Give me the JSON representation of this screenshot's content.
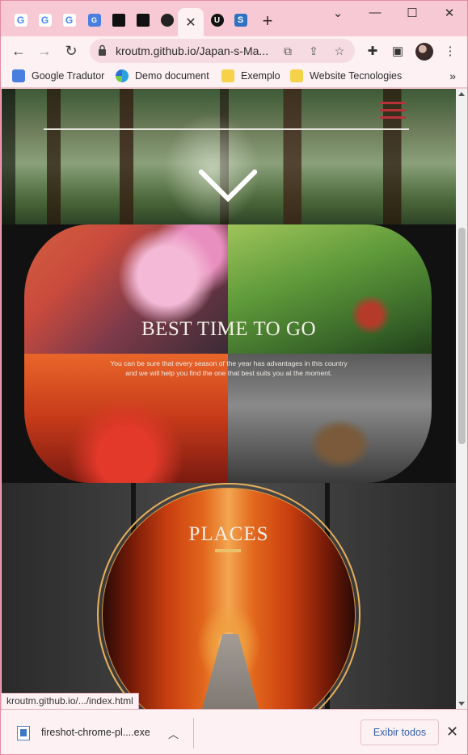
{
  "browser": {
    "tabs": [
      {
        "icon": "google-icon"
      },
      {
        "icon": "google-icon"
      },
      {
        "icon": "google-icon"
      },
      {
        "icon": "translate-icon"
      },
      {
        "icon": "site-icon"
      },
      {
        "icon": "site-icon"
      },
      {
        "icon": "github-icon"
      },
      {
        "icon": "close-icon",
        "active": true
      },
      {
        "icon": "u-icon"
      },
      {
        "icon": "s-icon"
      }
    ],
    "new_tab_label": "+",
    "url": "kroutm.github.io/Japan-s-Ma...",
    "bookmarks": [
      {
        "label": "Google Tradutor",
        "icon": "translate-icon"
      },
      {
        "label": "Demo document",
        "icon": "edge-icon"
      },
      {
        "label": "Exemplo",
        "icon": "folder-icon"
      },
      {
        "label": "Website Tecnologies",
        "icon": "folder-icon"
      }
    ],
    "bookmarks_more": "»"
  },
  "page": {
    "best_time": {
      "title": "BEST TIME TO GO",
      "text": "You can be sure that every season of the year has advantages in this country and we will help you find the one that best suits you at the moment."
    },
    "places": {
      "title": "PLACES"
    },
    "colors": {
      "accent_red": "#b8323a",
      "gold": "#e8b05a"
    }
  },
  "status_bar": {
    "text": "kroutm.github.io/.../index.html"
  },
  "downloads": {
    "file_name": "fireshot-chrome-pl....exe",
    "show_all": "Exibir todos"
  }
}
